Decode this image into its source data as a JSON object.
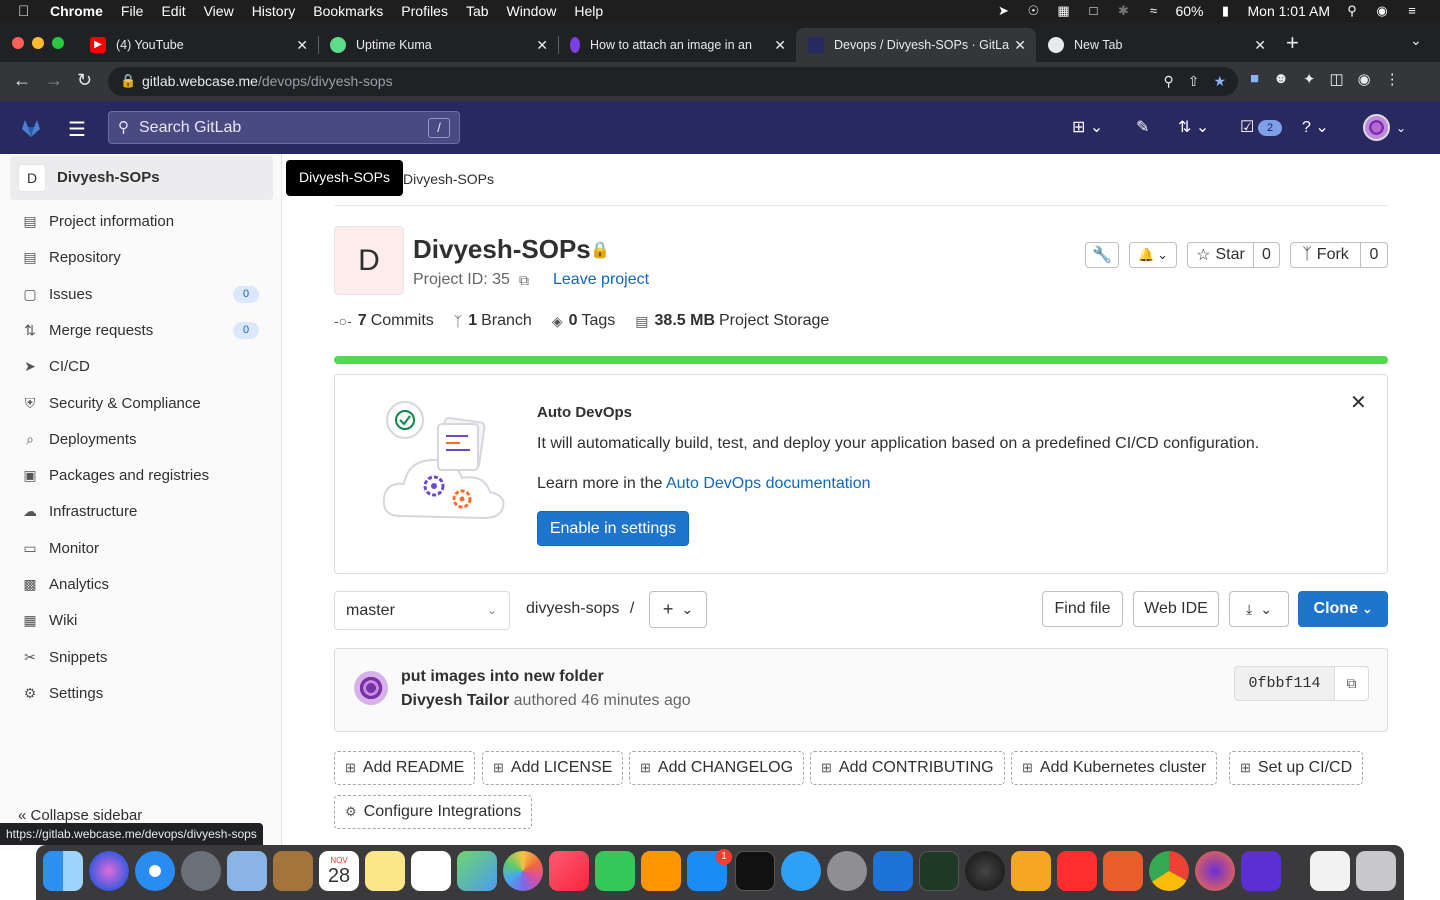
{
  "menubar": {
    "app": "Chrome",
    "items": [
      "File",
      "Edit",
      "View",
      "History",
      "Bookmarks",
      "Profiles",
      "Tab",
      "Window",
      "Help"
    ],
    "battery": "60%",
    "clock": "Mon 1:01 AM"
  },
  "tabs": [
    {
      "title": "(4) YouTube"
    },
    {
      "title": "Uptime Kuma"
    },
    {
      "title": "How to attach an image in an"
    },
    {
      "title": "Devops / Divyesh-SOPs · GitLa"
    },
    {
      "title": "New Tab"
    }
  ],
  "address": {
    "host": "gitlab.webcase.me",
    "path": "/devops/divyesh-sops"
  },
  "header": {
    "search_placeholder": "Search GitLab",
    "search_shortcut": "/",
    "todo_count": "2"
  },
  "sidebar": {
    "project_initial": "D",
    "project_name": "Divyesh-SOPs",
    "items": [
      {
        "label": "Project information",
        "icon": "info-doc-icon"
      },
      {
        "label": "Repository",
        "icon": "doc-icon"
      },
      {
        "label": "Issues",
        "icon": "issues-icon",
        "count": "0"
      },
      {
        "label": "Merge requests",
        "icon": "merge-request-icon",
        "count": "0"
      },
      {
        "label": "CI/CD",
        "icon": "rocket-icon"
      },
      {
        "label": "Security & Compliance",
        "icon": "shield-icon"
      },
      {
        "label": "Deployments",
        "icon": "deployments-icon"
      },
      {
        "label": "Packages and registries",
        "icon": "package-icon"
      },
      {
        "label": "Infrastructure",
        "icon": "cloud-gear-icon"
      },
      {
        "label": "Monitor",
        "icon": "monitor-icon"
      },
      {
        "label": "Analytics",
        "icon": "chart-icon"
      },
      {
        "label": "Wiki",
        "icon": "book-icon"
      },
      {
        "label": "Snippets",
        "icon": "scissors-icon"
      },
      {
        "label": "Settings",
        "icon": "gear-icon"
      }
    ],
    "collapse_label": "Collapse sidebar"
  },
  "status_url": "https://gitlab.webcase.me/devops/divyesh-sops",
  "tooltip": "Divyesh-SOPs",
  "breadcrumb": "Divyesh-SOPs",
  "project": {
    "initial": "D",
    "title": "Divyesh-SOPs",
    "project_id": "Project ID: 35",
    "leave_label": "Leave project",
    "star_label": "Star",
    "star_count": "0",
    "fork_label": "Fork",
    "fork_count": "0",
    "stats": [
      {
        "value": "7",
        "label": "Commits"
      },
      {
        "value": "1",
        "label": "Branch"
      },
      {
        "value": "0",
        "label": "Tags"
      },
      {
        "value": "38.5 MB",
        "label": "Project Storage"
      }
    ],
    "storage_fill_percent": 100
  },
  "autodevops": {
    "title": "Auto DevOps",
    "description": "It will automatically build, test, and deploy your application based on a predefined CI/CD configuration.",
    "learn_prefix": "Learn more in the",
    "learn_link": "Auto DevOps documentation",
    "button": "Enable in settings"
  },
  "repo": {
    "branch": "master",
    "path": "divyesh-sops",
    "path_sep": "/",
    "find_file": "Find file",
    "web_ide": "Web IDE",
    "clone": "Clone"
  },
  "commit": {
    "title": "put images into new folder",
    "author": "Divyesh Tailor",
    "authored": "authored 46 minutes ago",
    "sha": "0fbbf114"
  },
  "actions": [
    "Add README",
    "Add LICENSE",
    "Add CHANGELOG",
    "Add CONTRIBUTING",
    "Add Kubernetes cluster",
    "Set up CI/CD",
    "Configure Integrations"
  ],
  "dock": {
    "calendar_month": "NOV",
    "calendar_day": "28",
    "appstore_badge": "1"
  },
  "colors": {
    "gitlab_header": "#292961",
    "accent_blue": "#1f75cb",
    "progress_green": "#52d94f"
  }
}
